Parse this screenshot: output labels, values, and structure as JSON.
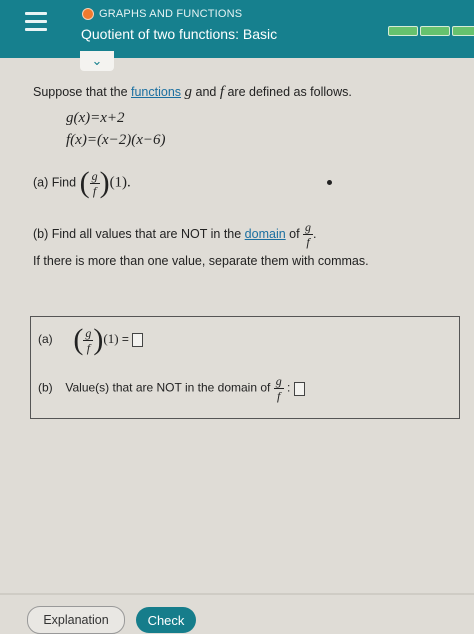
{
  "header": {
    "topic": "GRAPHS AND FUNCTIONS",
    "title": "Quotient of two functions: Basic"
  },
  "question": {
    "intro_before": "Suppose that the ",
    "intro_link": "functions",
    "intro_var_g": "g",
    "intro_and": " and ",
    "intro_var_f": "f",
    "intro_after": " are defined as follows.",
    "g_def": "g(x)=x+2",
    "f_def": "f(x)=(x−2)(x−6)",
    "part_a_label": "(a) Find",
    "frac_num": "g",
    "frac_den": "f",
    "eval_arg": "(1).",
    "part_b_text": "(b) Find all values that are NOT in the ",
    "part_b_link": "domain",
    "part_b_of": " of ",
    "part_b_period": ".",
    "part_b_note": "If there is more than one value, separate them with commas."
  },
  "answers": {
    "a_label": "(a)",
    "a_arg": "(1)",
    "a_equals": "=",
    "b_label": "(b)",
    "b_text": "Value(s) that are NOT in the domain of",
    "b_colon": ":"
  },
  "footer": {
    "explanation": "Explanation",
    "check": "Check"
  },
  "colors": {
    "header_bg": "#16808e",
    "topic_dot": "#ef7a2e",
    "progress": "#66c26e",
    "check_button": "#167d8b"
  }
}
